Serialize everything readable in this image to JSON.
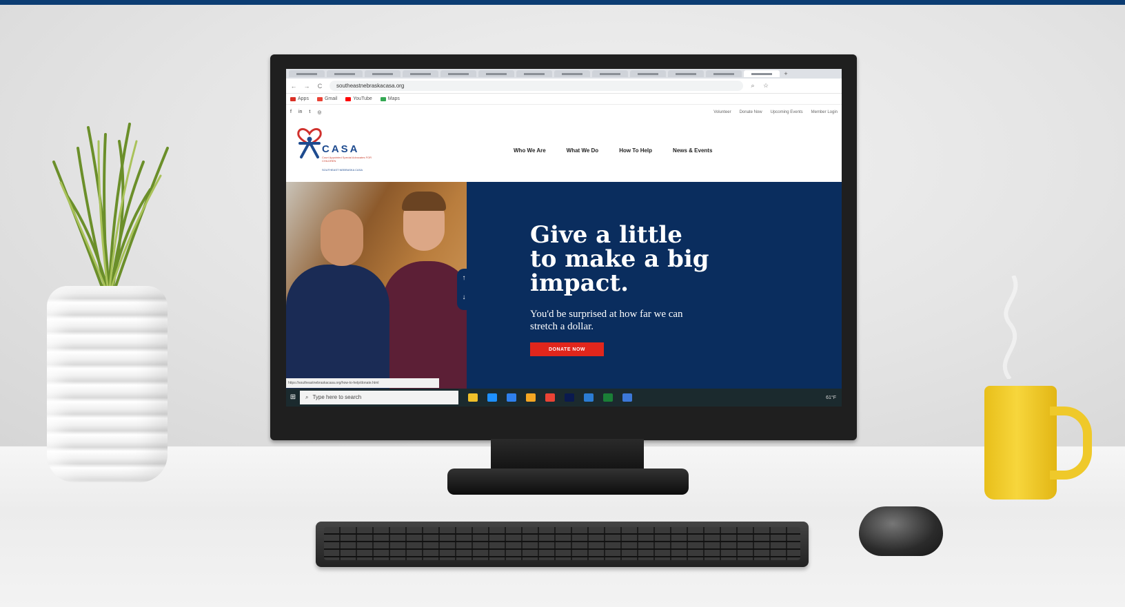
{
  "browser": {
    "tab_count": 13,
    "new_tab": "+",
    "url": "southeastnebraskacasa.org",
    "nav": {
      "back": "←",
      "forward": "→",
      "reload": "C"
    },
    "bookmarks": [
      {
        "label": "Apps",
        "color": "#d93025"
      },
      {
        "label": "Gmail",
        "color": "#ea4335"
      },
      {
        "label": "YouTube",
        "color": "#ff0000"
      },
      {
        "label": "Maps",
        "color": "#34a853"
      }
    ]
  },
  "site": {
    "socials": [
      "f",
      "in",
      "t",
      "◎"
    ],
    "utility_links": [
      "Volunteer",
      "Donate Now",
      "Upcoming Events",
      "Member Login"
    ],
    "logo": {
      "name": "CASA",
      "sub": "Court Appointed Special Advocates FOR CHILDREN",
      "tag": "SOUTHEAST NEBRASKA CASA"
    },
    "nav": [
      "Who We Are",
      "What We Do",
      "How To Help",
      "News & Events"
    ],
    "hero": {
      "title": "Give a little to make a big impact.",
      "subtitle": "You'd be surprised at how far we can stretch a dollar.",
      "button": "DONATE NOW",
      "arrow_up": "↑",
      "arrow_down": "↓"
    },
    "status_url": "https://southeastnebraskacasa.org/how-to-help/donate.html"
  },
  "taskbar": {
    "start": "⊞",
    "search_placeholder": "Type here to search",
    "tray_text": "61°F",
    "icon_colors": [
      "#f0c02a",
      "#1e90ff",
      "#2f80ed",
      "#f5a623",
      "#ea4335",
      "#0a1a4f",
      "#2b7cd3",
      "#1a7f37",
      "#3c78d8"
    ]
  },
  "colors": {
    "hero_blue": "#0a2d5e",
    "donate_red": "#e1261c",
    "top_bar": "#0c3d73"
  }
}
